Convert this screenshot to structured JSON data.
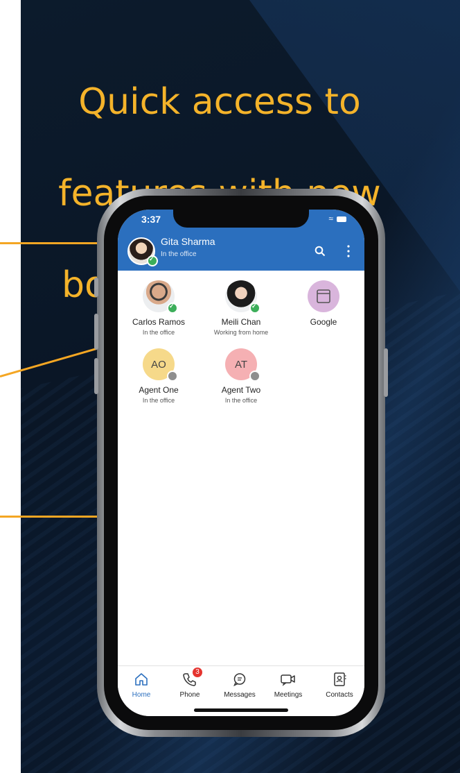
{
  "headline": [
    "Quick access to",
    "features with new",
    "bottom menu bar"
  ],
  "status_bar": {
    "time": "3:37"
  },
  "header": {
    "user_name": "Gita Sharma",
    "user_status": "In the office"
  },
  "contacts": [
    {
      "name": "Carlos Ramos",
      "status": "In the office",
      "initials": "",
      "presence": "available"
    },
    {
      "name": "Meili Chan",
      "status": "Working from home",
      "initials": "",
      "presence": "available"
    },
    {
      "name": "Google",
      "status": "",
      "initials": "",
      "presence": ""
    },
    {
      "name": "Agent One",
      "status": "In the office",
      "initials": "AO",
      "presence": "offline"
    },
    {
      "name": "Agent Two",
      "status": "In the office",
      "initials": "AT",
      "presence": "offline"
    }
  ],
  "tabs": [
    {
      "label": "Home",
      "icon": "home-icon",
      "active": true
    },
    {
      "label": "Phone",
      "icon": "phone-icon",
      "badge": "3"
    },
    {
      "label": "Messages",
      "icon": "message-icon"
    },
    {
      "label": "Meetings",
      "icon": "video-icon"
    },
    {
      "label": "Contacts",
      "icon": "contacts-book-icon"
    }
  ],
  "colors": {
    "brand_blue": "#2b6fbe",
    "accent_orange": "#f4b32a",
    "badge_red": "#e5342f",
    "available_green": "#3cae5a"
  }
}
